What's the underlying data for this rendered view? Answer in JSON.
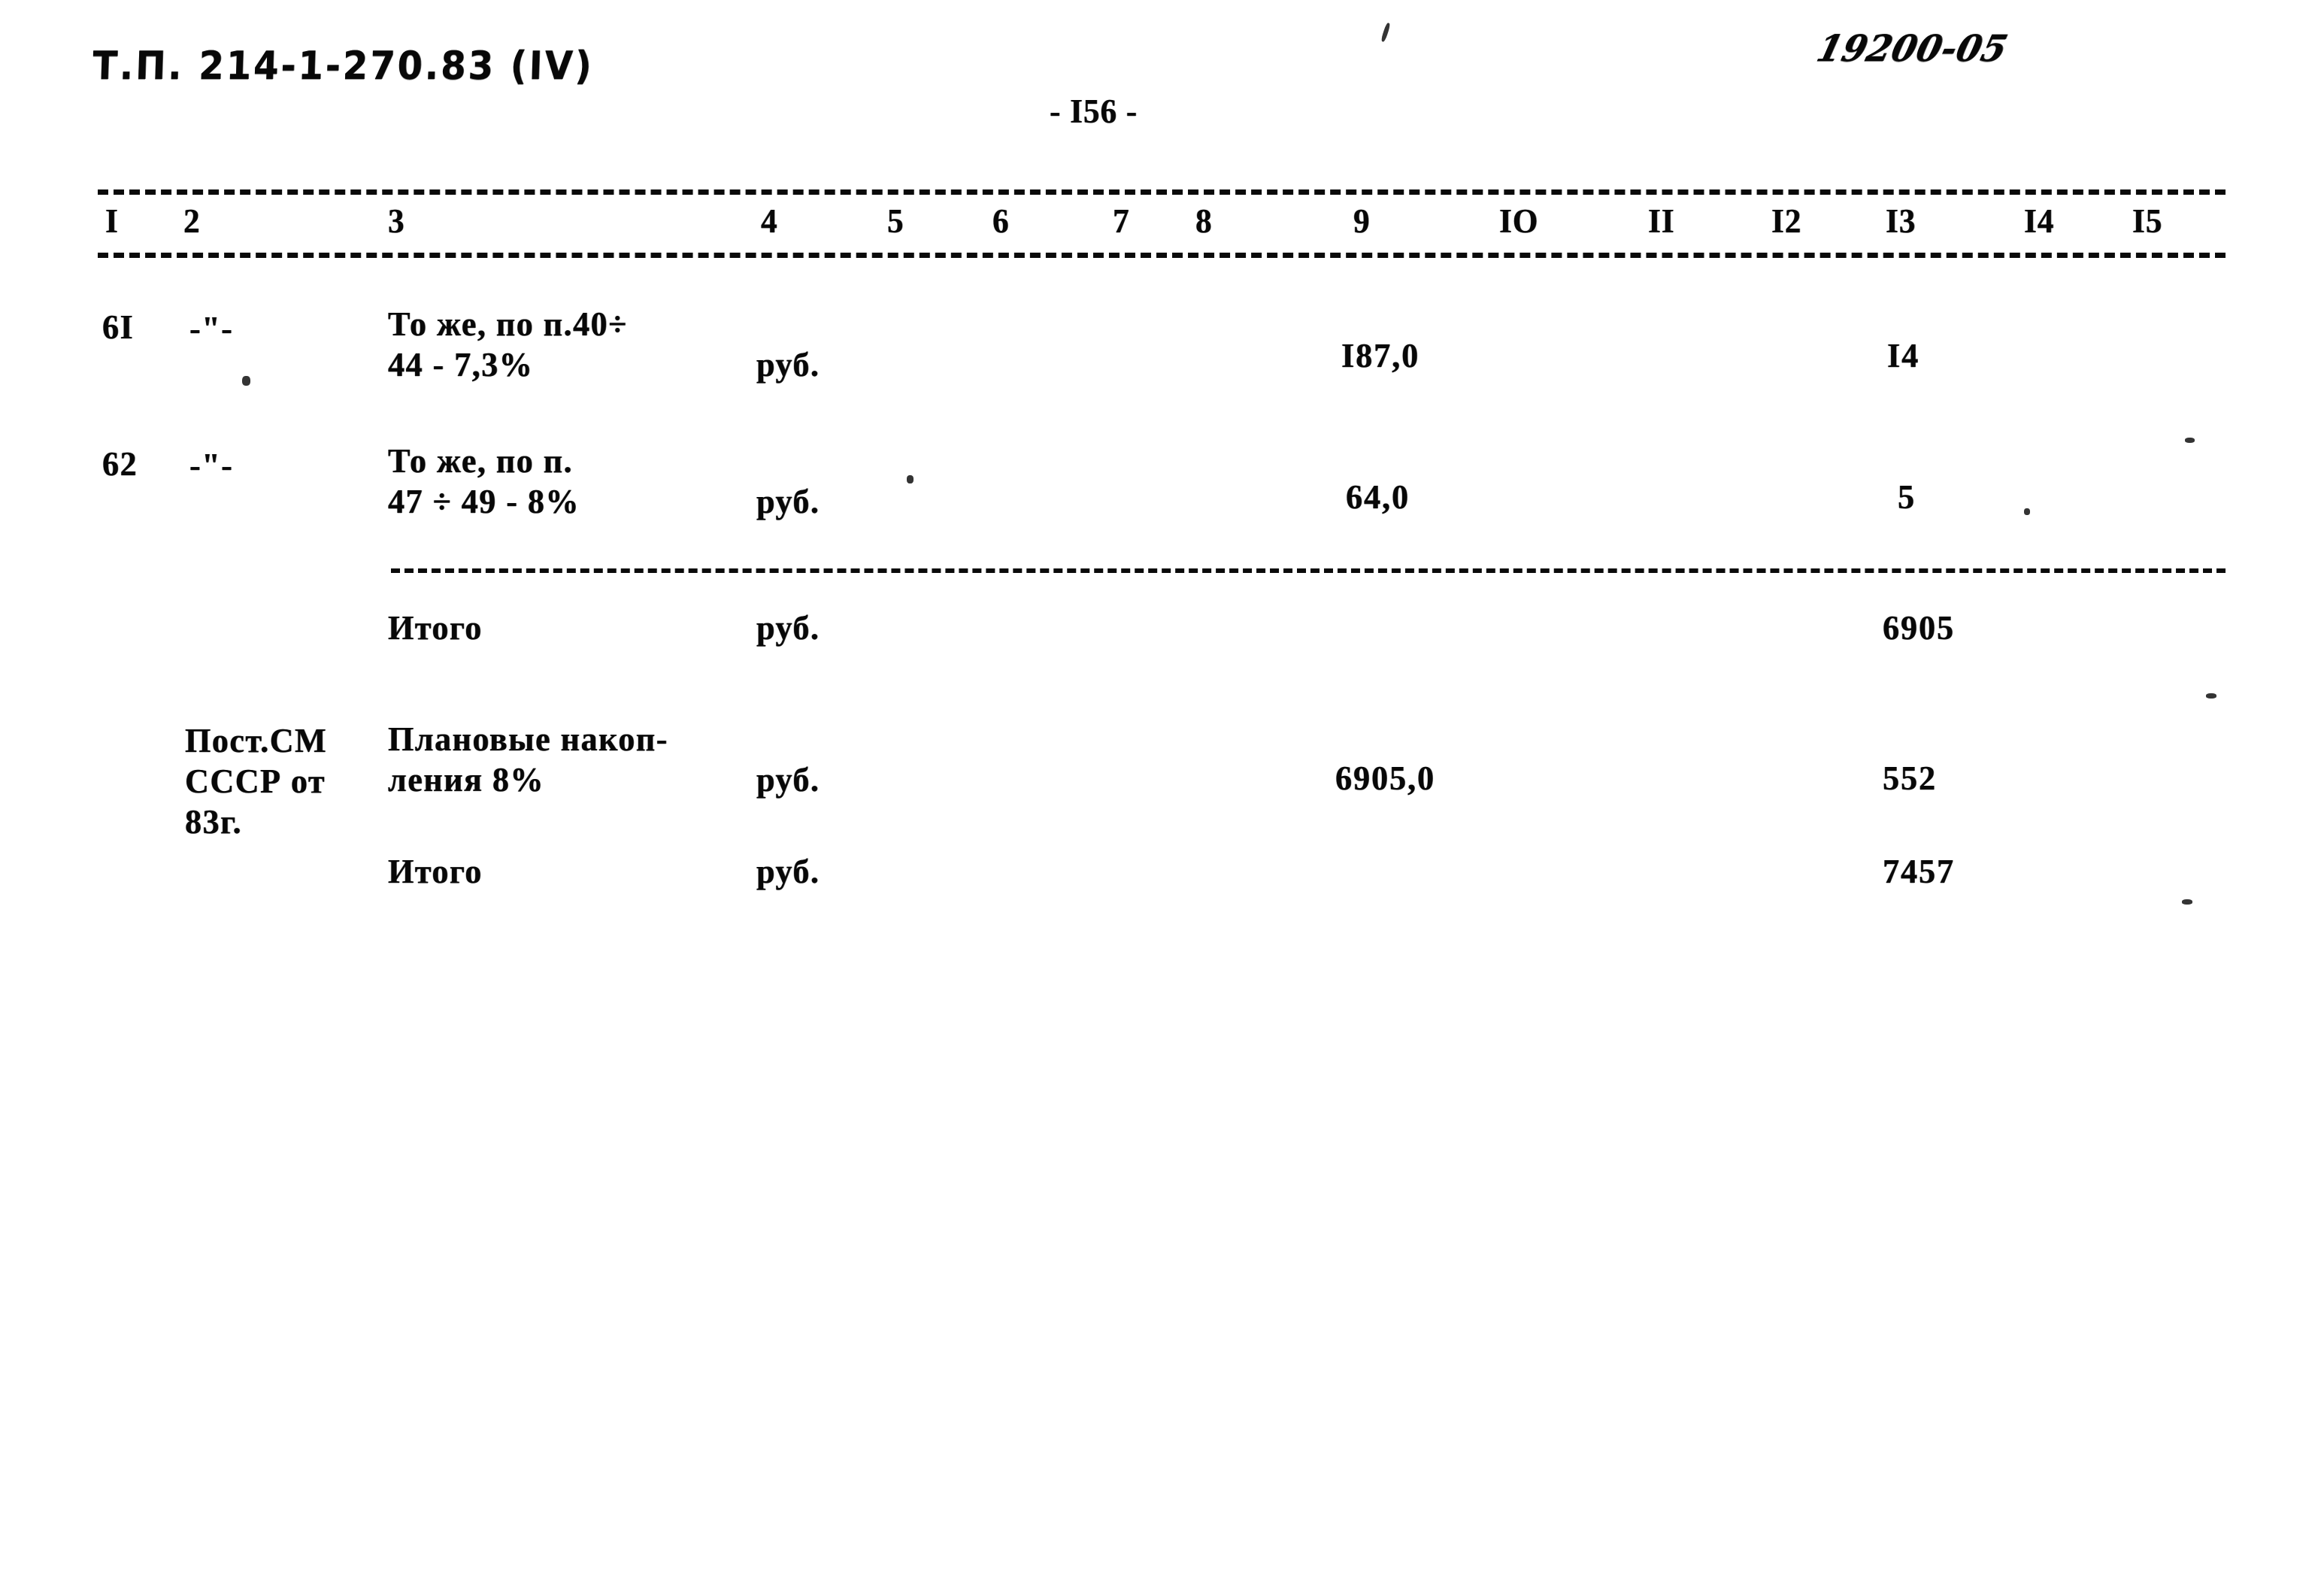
{
  "document": {
    "project_code": "Т.П. 214-1-270.83 (IV)",
    "archive_number": "19200-05",
    "page_marker": "- I56 -"
  },
  "table": {
    "column_headers": [
      "I",
      "2",
      "3",
      "4",
      "5",
      "6",
      "7",
      "8",
      "9",
      "IO",
      "II",
      "I2",
      "I3",
      "I4",
      "I5"
    ],
    "rows": [
      {
        "num": "6I",
        "basis": "-\"-",
        "name_line1": "То же, по п.40÷",
        "name_line2": "44 - 7,3%",
        "unit": "руб.",
        "col9": "I87,0",
        "col13": "I4"
      },
      {
        "num": "62",
        "basis": "-\"-",
        "name_line1": "То же, по п.",
        "name_line2": "47 ÷ 49 - 8%",
        "unit": "руб.",
        "col9": "64,0",
        "col13": "5"
      },
      {
        "num": "",
        "basis": "",
        "name_line1": "Итого",
        "name_line2": "",
        "unit": "руб.",
        "col9": "",
        "col13": "6905"
      },
      {
        "num": "",
        "basis_line1": "Пост.СМ",
        "basis_line2": "СССР от",
        "basis_line3": "83г.",
        "basis": "",
        "name_line1": "Плановые накоп-",
        "name_line2": "ления 8%",
        "unit": "руб.",
        "col9": "6905,0",
        "col13": "552"
      },
      {
        "num": "",
        "basis": "",
        "name_line1": "Итого",
        "name_line2": "",
        "unit": "руб.",
        "col9": "",
        "col13": "7457"
      }
    ]
  },
  "colors": {
    "ink": "#0a0a0a",
    "paper": "#ffffff"
  }
}
